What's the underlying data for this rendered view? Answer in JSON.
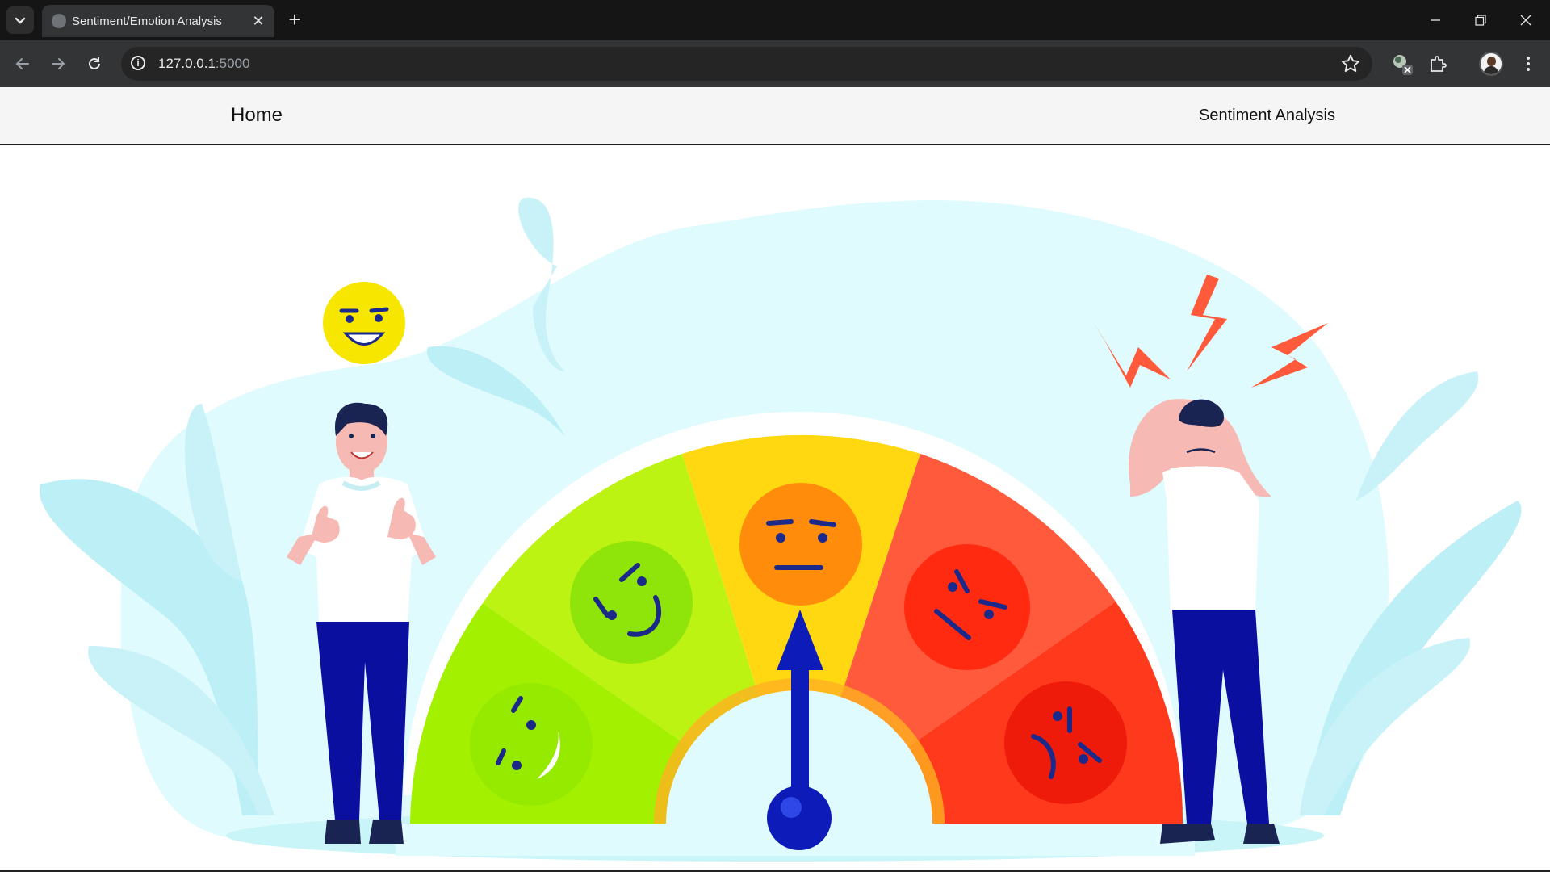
{
  "browser": {
    "tab_title": "Sentiment/Emotion Analysis",
    "url_host": "127.0.0.1",
    "url_port": ":5000",
    "icons": [
      "tab-list-icon",
      "globe-icon",
      "close-icon",
      "plus-icon",
      "minimize-icon",
      "restore-icon",
      "window-close-icon",
      "back-icon",
      "forward-icon",
      "reload-icon",
      "info-icon",
      "star-icon",
      "extension-icon",
      "puzzle-icon",
      "avatar",
      "more-icon"
    ]
  },
  "nav": {
    "home": "Home",
    "sentiment": "Sentiment Analysis"
  },
  "hero": {
    "gauge_levels": [
      "very-happy",
      "happy",
      "neutral",
      "sad",
      "angry"
    ],
    "needle_level": "neutral",
    "colors": {
      "very_happy": "#a3f000",
      "happy": "#bdf312",
      "neutral": "#ffd812",
      "sad": "#ff5a3c",
      "angry": "#ff3a1c",
      "needle": "#0d1cb8",
      "backdrop": "#e0fbfd"
    }
  }
}
